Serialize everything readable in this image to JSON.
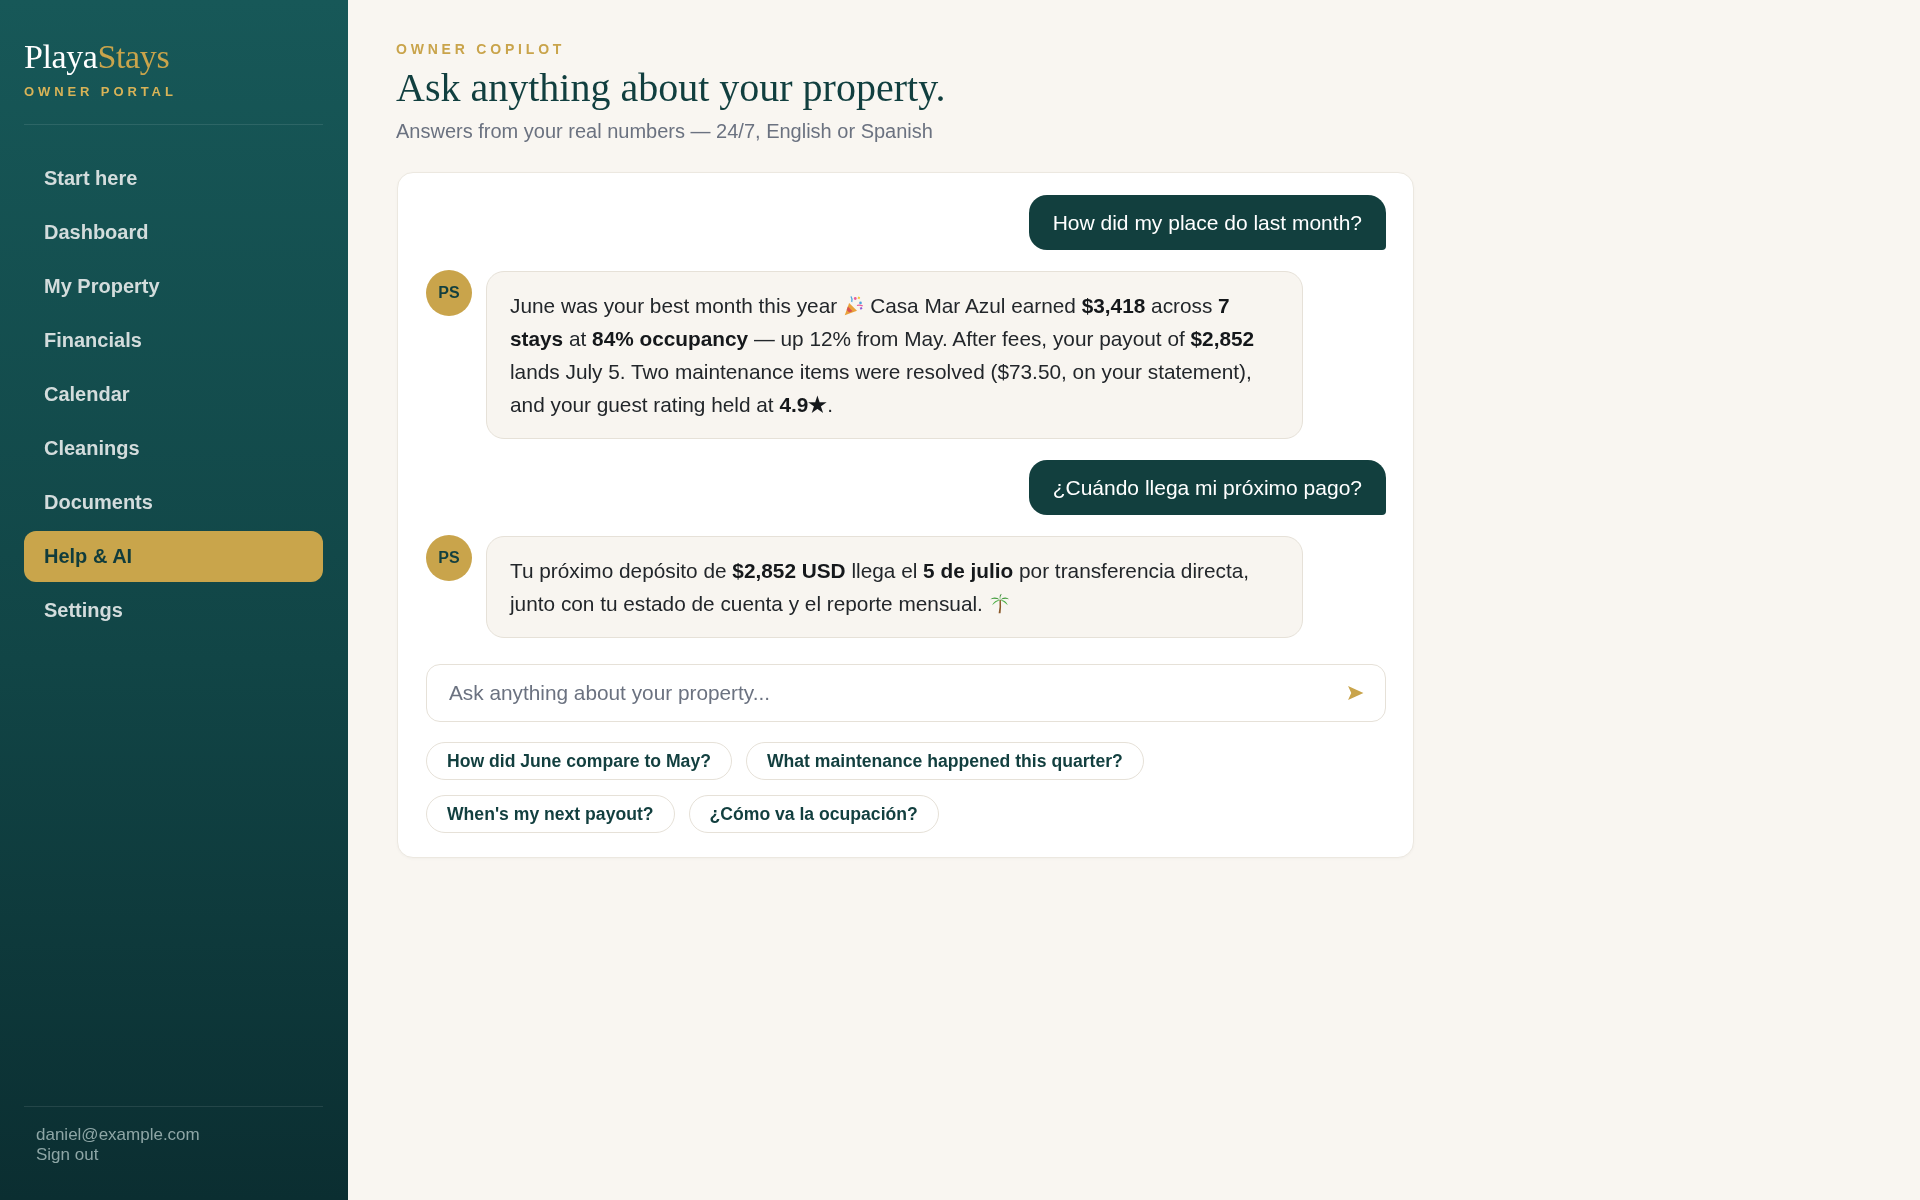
{
  "sidebar": {
    "brand": {
      "name": "Playa",
      "name_accent": "Stays",
      "tagline": "OWNER PORTAL"
    },
    "nav_items": [
      {
        "label": "Start here",
        "selected": false
      },
      {
        "label": "Dashboard",
        "selected": false
      },
      {
        "label": "My Property",
        "selected": false
      },
      {
        "label": "Financials",
        "selected": false
      },
      {
        "label": "Calendar",
        "selected": false
      },
      {
        "label": "Cleanings",
        "selected": false
      },
      {
        "label": "Documents",
        "selected": false
      },
      {
        "label": "Help & AI",
        "selected": true
      },
      {
        "label": "Settings",
        "selected": false
      }
    ],
    "account": {
      "email": "daniel@example.com",
      "sign_out": "Sign out"
    }
  },
  "header": {
    "eyebrow": "OWNER COPILOT",
    "title": "Ask anything about your property.",
    "subtitle": "Answers from your real numbers — 24/7, English or Spanish"
  },
  "chat": {
    "messages": [
      {
        "kind": "user",
        "text": "How did my place do last month?"
      },
      {
        "kind": "assistant",
        "avatar": "PS",
        "segments": [
          {
            "kind": "text",
            "text": "June was your best month this year"
          },
          {
            "kind": "confetti"
          },
          {
            "kind": "text",
            "text": "Casa Mar Azul earned **$3,418** across **7 stays** at **84% occupancy** — up 12% from May. After fees, your payout of **$2,852** lands July 5. Two maintenance items were resolved ($73.50, on your statement), and your guest rating held at **4.9★**."
          }
        ]
      },
      {
        "kind": "user",
        "text": "¿Cuándo llega mi próximo pago?"
      },
      {
        "kind": "assistant",
        "avatar": "PS",
        "segments": [
          {
            "kind": "text",
            "text": "Tu próximo depósito de **$2,852 USD** llega el **5 de julio** por transferencia directa, junto con tu estado de cuenta y el reporte mensual."
          },
          {
            "kind": "palm"
          }
        ]
      }
    ],
    "composer": {
      "placeholder": "Ask anything about your property..."
    },
    "suggestions": [
      "How did June compare to May?",
      "What maintenance happened this quarter?",
      "When's my next payout?",
      "¿Cómo va la ocupación?"
    ]
  }
}
